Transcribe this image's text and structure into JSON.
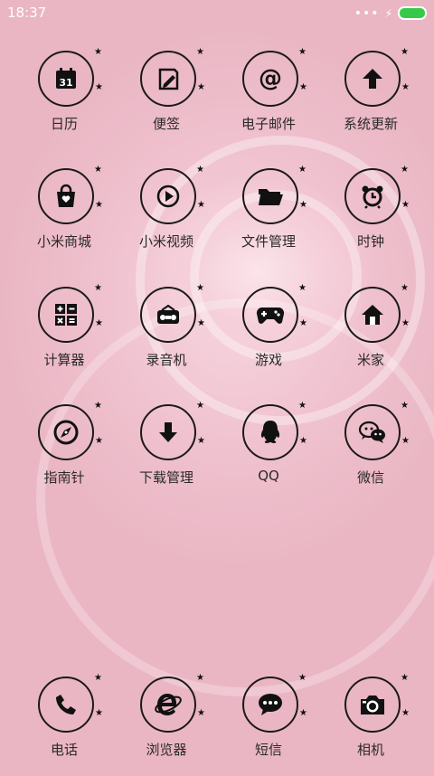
{
  "status_bar": {
    "time": "18:37",
    "signal_dots": "•••",
    "charging_icon": "⚡",
    "battery_color": "#38c94a"
  },
  "apps": [
    {
      "label": "日历",
      "icon": "calendar-icon",
      "badge": "31"
    },
    {
      "label": "便签",
      "icon": "notes-icon"
    },
    {
      "label": "电子邮件",
      "icon": "email-icon",
      "badge": "@"
    },
    {
      "label": "系统更新",
      "icon": "update-icon"
    },
    {
      "label": "小米商城",
      "icon": "shopping-bag-icon"
    },
    {
      "label": "小米视频",
      "icon": "video-icon"
    },
    {
      "label": "文件管理",
      "icon": "folder-icon"
    },
    {
      "label": "时钟",
      "icon": "clock-icon"
    },
    {
      "label": "计算器",
      "icon": "calculator-icon"
    },
    {
      "label": "录音机",
      "icon": "recorder-icon"
    },
    {
      "label": "游戏",
      "icon": "gamepad-icon"
    },
    {
      "label": "米家",
      "icon": "home-icon"
    },
    {
      "label": "指南针",
      "icon": "compass-icon"
    },
    {
      "label": "下载管理",
      "icon": "download-icon"
    },
    {
      "label": "QQ",
      "icon": "qq-icon"
    },
    {
      "label": "微信",
      "icon": "wechat-icon"
    }
  ],
  "dock": [
    {
      "label": "电话",
      "icon": "phone-icon"
    },
    {
      "label": "浏览器",
      "icon": "browser-icon"
    },
    {
      "label": "短信",
      "icon": "sms-icon"
    },
    {
      "label": "相机",
      "icon": "camera-icon"
    }
  ],
  "theme": {
    "ring_color": "#1a1a1a",
    "label_color": "#2a2a2a"
  }
}
